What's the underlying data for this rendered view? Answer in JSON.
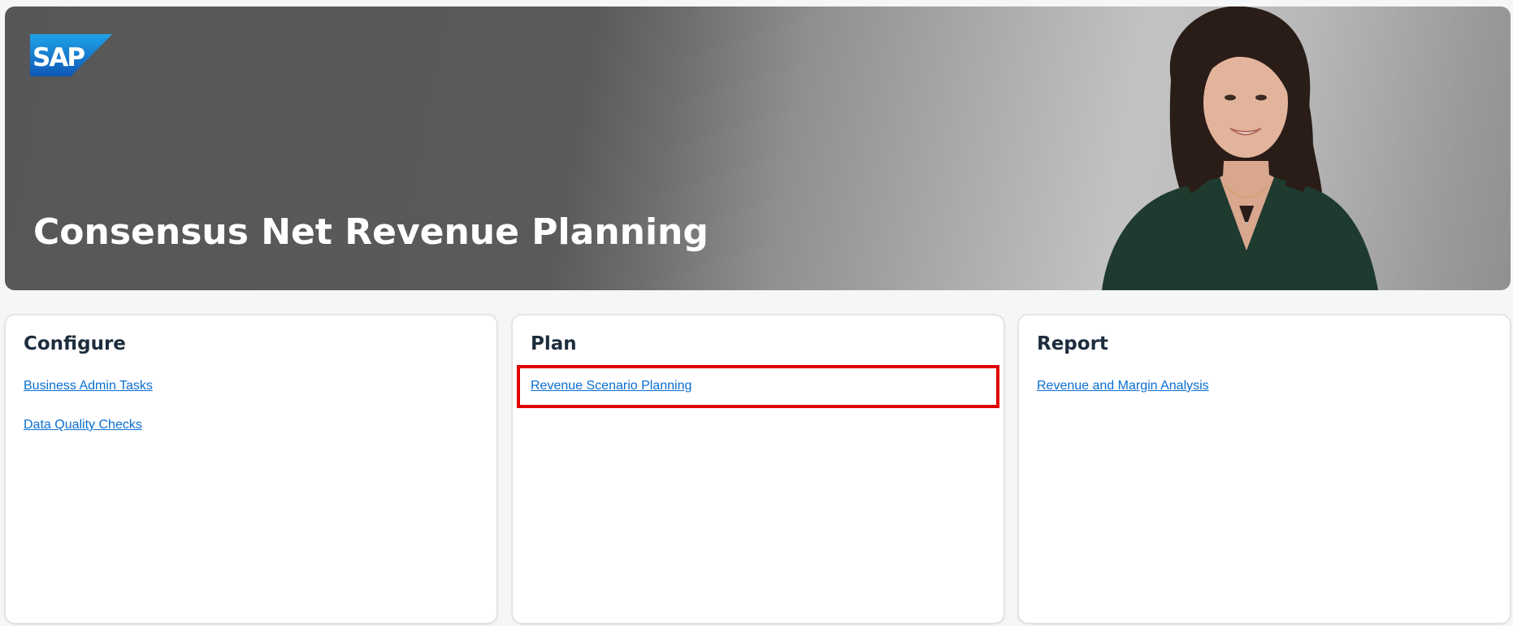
{
  "header": {
    "logo_text": "SAP",
    "title": "Consensus Net Revenue Planning"
  },
  "cards": [
    {
      "title": "Configure",
      "links": [
        "Business Admin Tasks",
        "Data Quality Checks"
      ]
    },
    {
      "title": "Plan",
      "links": [
        "Revenue Scenario Planning"
      ]
    },
    {
      "title": "Report",
      "links": [
        "Revenue and Margin Analysis"
      ]
    }
  ],
  "colors": {
    "link": "#0a6ed1",
    "title": "#1d2d3e",
    "highlight": "#e00000",
    "logo_blue_top": "#1fa3e8",
    "logo_blue_bottom": "#0f57b5"
  }
}
